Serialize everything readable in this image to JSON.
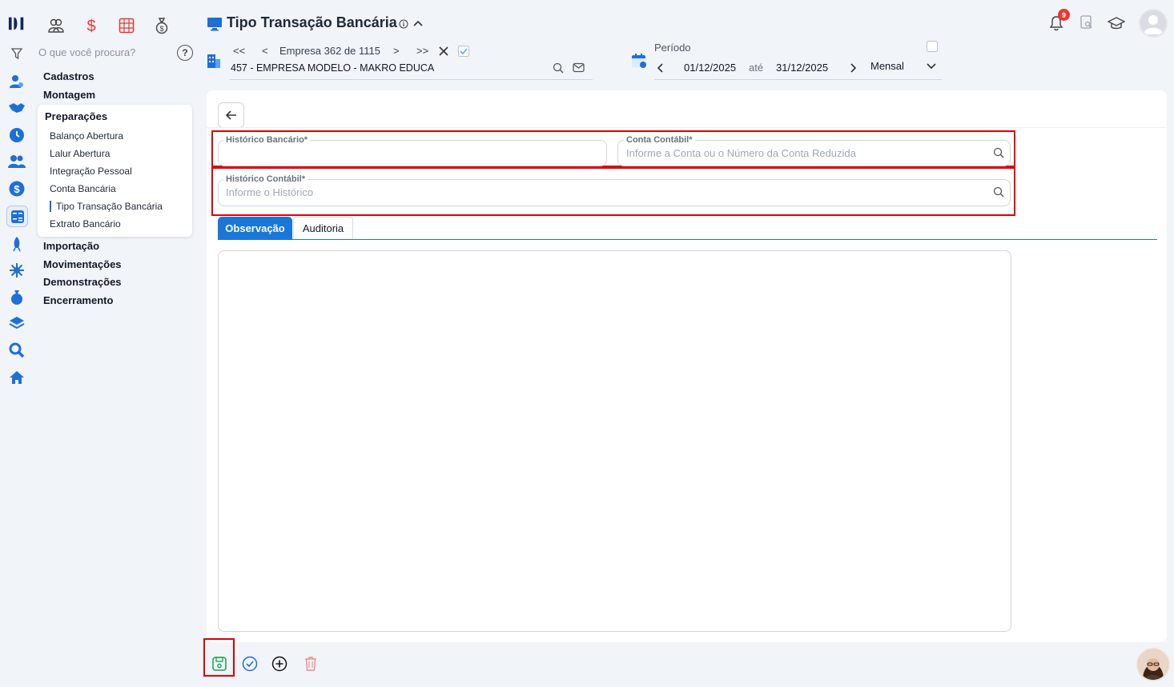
{
  "header": {
    "title": "Tipo Transação Bancária",
    "info_icon": "info-icon",
    "collapse_icon": "chevron-up-icon"
  },
  "search": {
    "placeholder": "O que você procura?",
    "help": "?"
  },
  "company": {
    "nav_label": "Empresa 362 de 1115",
    "name": "457 - EMPRESA MODELO - MAKRO EDUCA"
  },
  "period": {
    "label": "Período",
    "start": "01/12/2025",
    "separator": "até",
    "end": "31/12/2025",
    "frequency": "Mensal"
  },
  "notifications": {
    "count": "9"
  },
  "nav": {
    "sections": [
      "Cadastros",
      "Montagem"
    ],
    "submenu": {
      "title": "Preparações",
      "items": [
        "Balanço Abertura",
        "Lalur Abertura",
        "Integração Pessoal",
        "Conta Bancária",
        "Tipo Transação Bancária",
        "Extrato Bancário"
      ],
      "active": "Tipo Transação Bancária"
    },
    "sections_after": [
      "Importação",
      "Movimentações",
      "Demonstrações",
      "Encerramento"
    ]
  },
  "form": {
    "historico_bancario": {
      "label": "Histórico Bancário*",
      "value": ""
    },
    "conta_contabil": {
      "label": "Conta Contábil*",
      "placeholder": "Informe a Conta ou o Número da Conta Reduzida"
    },
    "historico_contabil": {
      "label": "Histórico Contábil*",
      "placeholder": "Informe o Histórico"
    }
  },
  "tabs": [
    {
      "label": "Observação",
      "active": true
    },
    {
      "label": "Auditoria",
      "active": false
    }
  ],
  "colors": {
    "accent": "#1877d8",
    "highlight": "#e00000",
    "save": "#16a34a",
    "delete": "#f28b8b",
    "rail_blue": "#1e6fd9"
  }
}
